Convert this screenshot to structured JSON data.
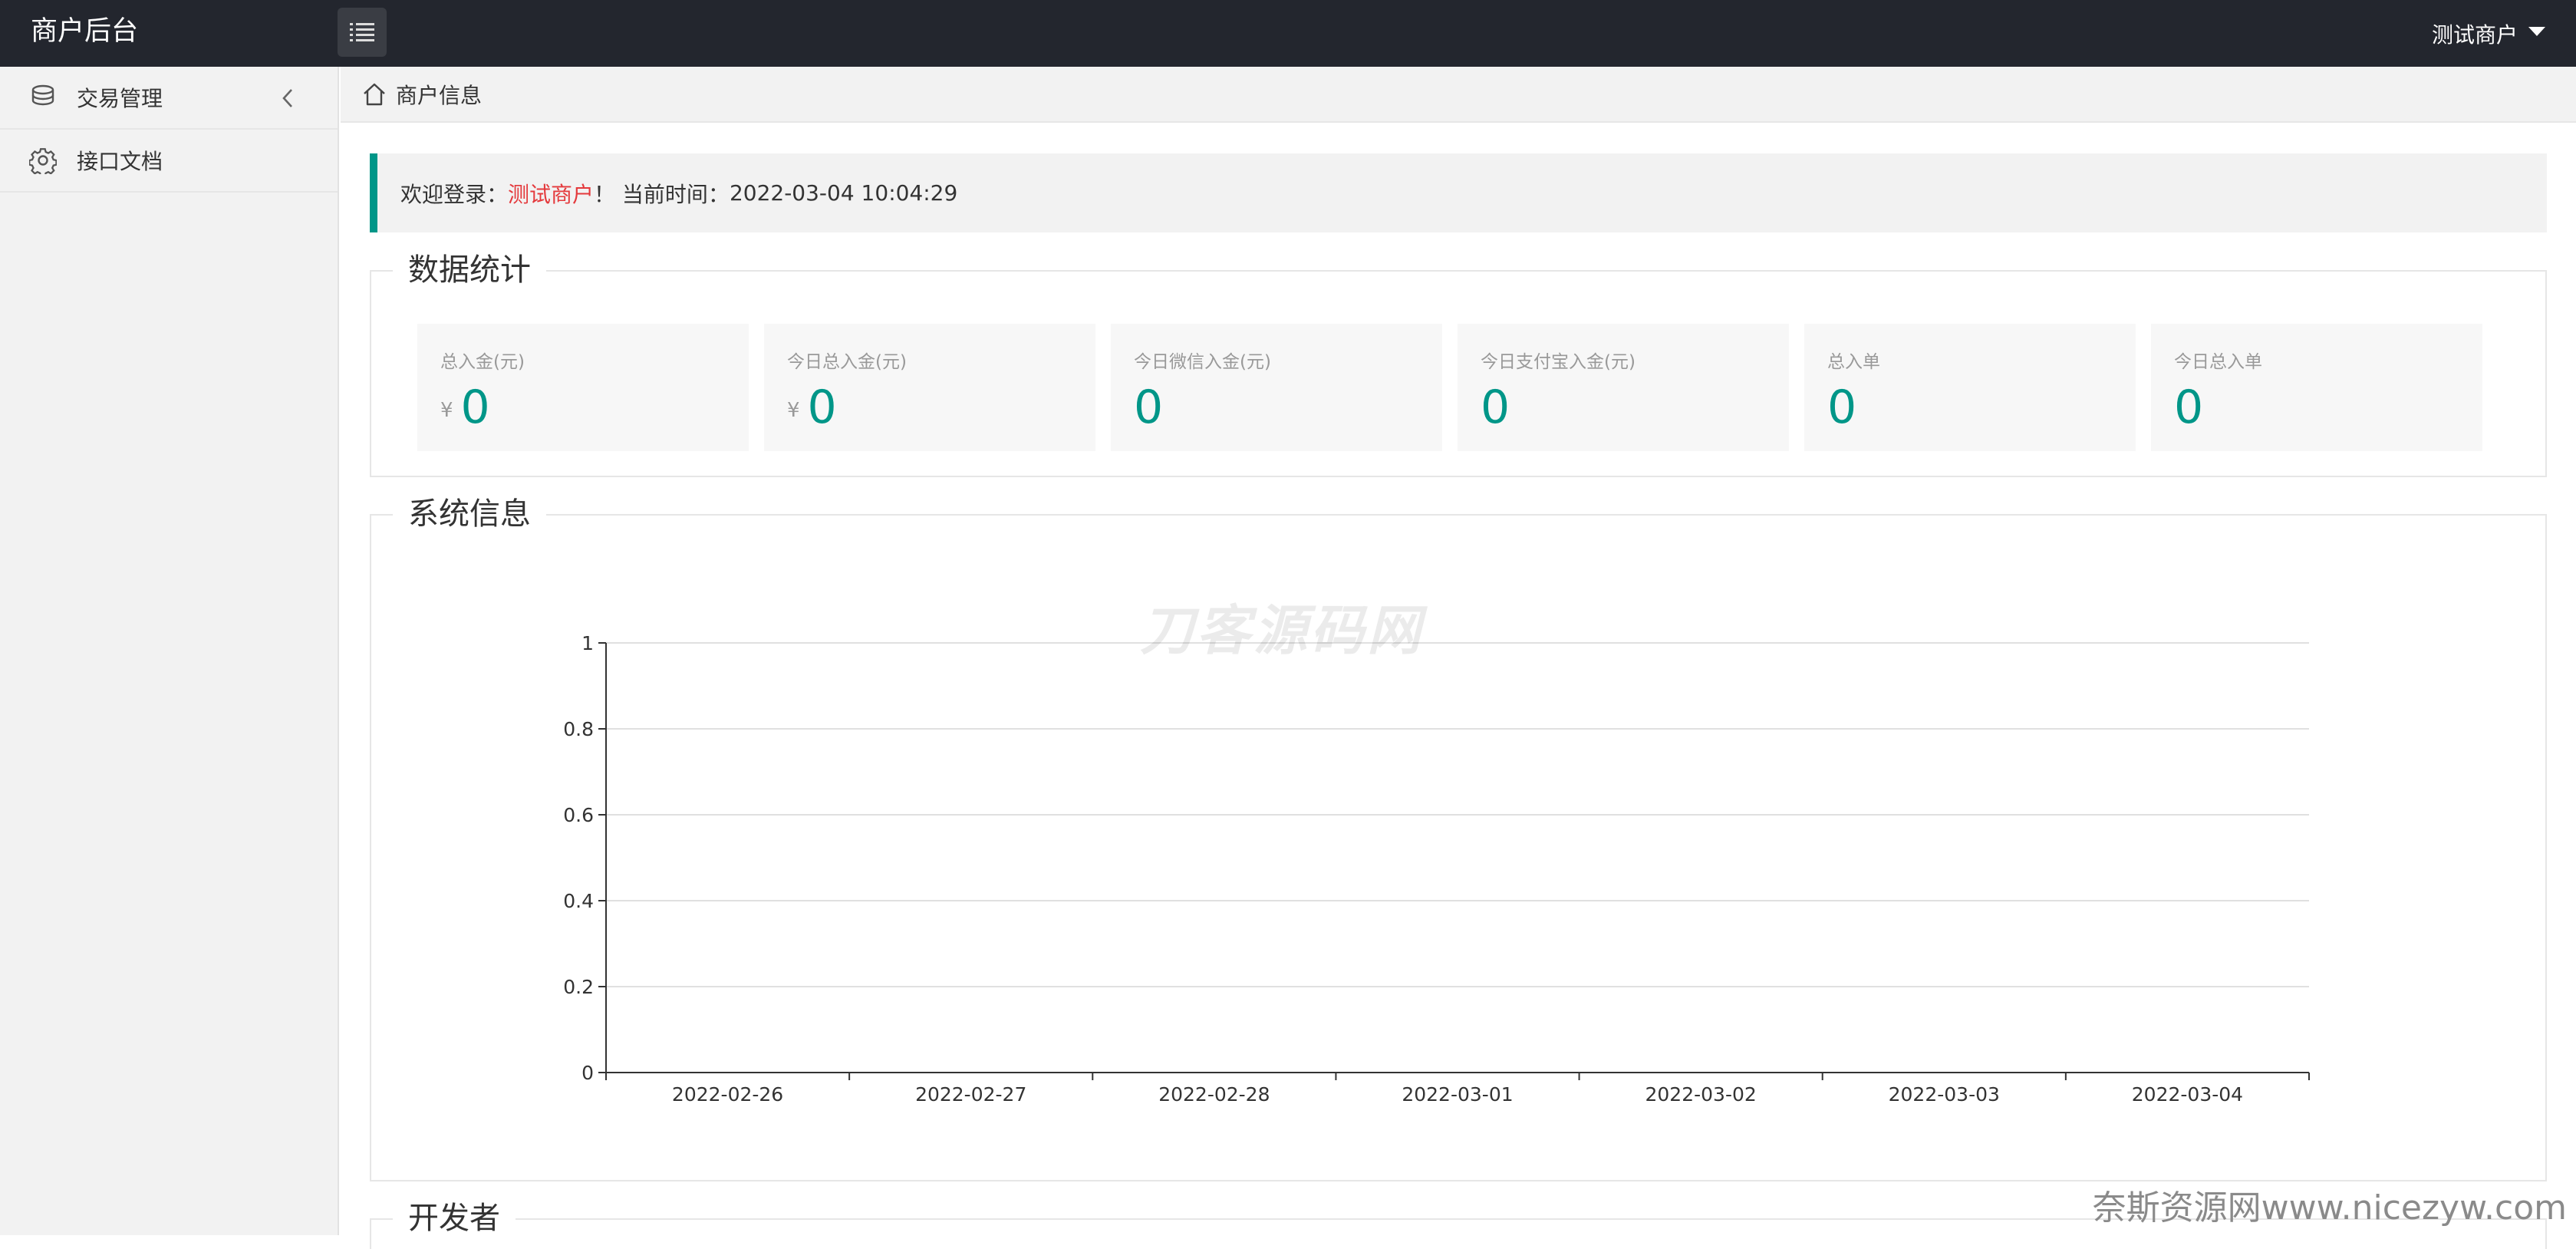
{
  "header": {
    "brand": "商户后台",
    "user_name": "测试商户"
  },
  "sidebar": {
    "items": [
      {
        "label": "交易管理",
        "icon": "database-icon",
        "has_submenu": true
      },
      {
        "label": "接口文档",
        "icon": "gear-icon",
        "has_submenu": false
      }
    ]
  },
  "breadcrumb": {
    "label": "商户信息"
  },
  "welcome": {
    "prefix": "欢迎登录：",
    "merchant": "测试商户",
    "suffix": "！ 当前时间：",
    "time": "2022-03-04 10:04:29"
  },
  "stats_section": {
    "title": "数据统计",
    "cards": [
      {
        "label": "总入金(元)",
        "currency": "¥",
        "value": "0"
      },
      {
        "label": "今日总入金(元)",
        "currency": "¥",
        "value": "0"
      },
      {
        "label": "今日微信入金(元)",
        "currency": "",
        "value": "0"
      },
      {
        "label": "今日支付宝入金(元)",
        "currency": "",
        "value": "0"
      },
      {
        "label": "总入单",
        "currency": "",
        "value": "0"
      },
      {
        "label": "今日总入单",
        "currency": "",
        "value": "0"
      }
    ]
  },
  "system_section": {
    "title": "系统信息"
  },
  "developer_section": {
    "title": "开发者"
  },
  "watermarks": {
    "center": "刀客源码网",
    "corner": "奈斯资源网www.nicezyw.com"
  },
  "colors": {
    "topbar": "#23262e",
    "accent": "#009688",
    "highlight": "#e4393c"
  },
  "chart_data": {
    "type": "line",
    "categories": [
      "2022-02-26",
      "2022-02-27",
      "2022-02-28",
      "2022-03-01",
      "2022-03-02",
      "2022-03-03",
      "2022-03-04"
    ],
    "series": [
      {
        "values": [
          0,
          0,
          0,
          0,
          0,
          0,
          0
        ]
      }
    ],
    "ylim": [
      0,
      1
    ],
    "yticks": [
      "0",
      "0.2",
      "0.4",
      "0.6",
      "0.8",
      "1"
    ],
    "grid": true
  }
}
